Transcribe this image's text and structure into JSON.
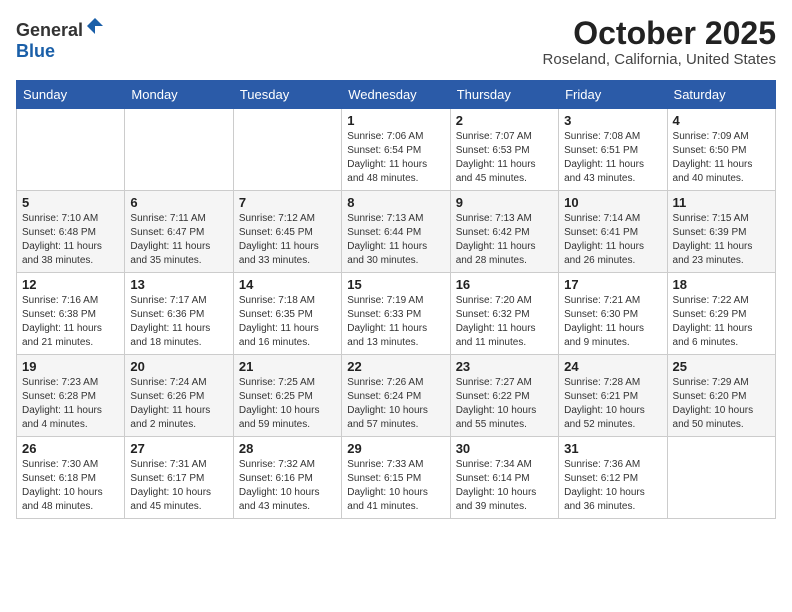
{
  "header": {
    "logo_general": "General",
    "logo_blue": "Blue",
    "month": "October 2025",
    "location": "Roseland, California, United States"
  },
  "weekdays": [
    "Sunday",
    "Monday",
    "Tuesday",
    "Wednesday",
    "Thursday",
    "Friday",
    "Saturday"
  ],
  "weeks": [
    [
      {
        "day": "",
        "info": ""
      },
      {
        "day": "",
        "info": ""
      },
      {
        "day": "",
        "info": ""
      },
      {
        "day": "1",
        "info": "Sunrise: 7:06 AM\nSunset: 6:54 PM\nDaylight: 11 hours\nand 48 minutes."
      },
      {
        "day": "2",
        "info": "Sunrise: 7:07 AM\nSunset: 6:53 PM\nDaylight: 11 hours\nand 45 minutes."
      },
      {
        "day": "3",
        "info": "Sunrise: 7:08 AM\nSunset: 6:51 PM\nDaylight: 11 hours\nand 43 minutes."
      },
      {
        "day": "4",
        "info": "Sunrise: 7:09 AM\nSunset: 6:50 PM\nDaylight: 11 hours\nand 40 minutes."
      }
    ],
    [
      {
        "day": "5",
        "info": "Sunrise: 7:10 AM\nSunset: 6:48 PM\nDaylight: 11 hours\nand 38 minutes."
      },
      {
        "day": "6",
        "info": "Sunrise: 7:11 AM\nSunset: 6:47 PM\nDaylight: 11 hours\nand 35 minutes."
      },
      {
        "day": "7",
        "info": "Sunrise: 7:12 AM\nSunset: 6:45 PM\nDaylight: 11 hours\nand 33 minutes."
      },
      {
        "day": "8",
        "info": "Sunrise: 7:13 AM\nSunset: 6:44 PM\nDaylight: 11 hours\nand 30 minutes."
      },
      {
        "day": "9",
        "info": "Sunrise: 7:13 AM\nSunset: 6:42 PM\nDaylight: 11 hours\nand 28 minutes."
      },
      {
        "day": "10",
        "info": "Sunrise: 7:14 AM\nSunset: 6:41 PM\nDaylight: 11 hours\nand 26 minutes."
      },
      {
        "day": "11",
        "info": "Sunrise: 7:15 AM\nSunset: 6:39 PM\nDaylight: 11 hours\nand 23 minutes."
      }
    ],
    [
      {
        "day": "12",
        "info": "Sunrise: 7:16 AM\nSunset: 6:38 PM\nDaylight: 11 hours\nand 21 minutes."
      },
      {
        "day": "13",
        "info": "Sunrise: 7:17 AM\nSunset: 6:36 PM\nDaylight: 11 hours\nand 18 minutes."
      },
      {
        "day": "14",
        "info": "Sunrise: 7:18 AM\nSunset: 6:35 PM\nDaylight: 11 hours\nand 16 minutes."
      },
      {
        "day": "15",
        "info": "Sunrise: 7:19 AM\nSunset: 6:33 PM\nDaylight: 11 hours\nand 13 minutes."
      },
      {
        "day": "16",
        "info": "Sunrise: 7:20 AM\nSunset: 6:32 PM\nDaylight: 11 hours\nand 11 minutes."
      },
      {
        "day": "17",
        "info": "Sunrise: 7:21 AM\nSunset: 6:30 PM\nDaylight: 11 hours\nand 9 minutes."
      },
      {
        "day": "18",
        "info": "Sunrise: 7:22 AM\nSunset: 6:29 PM\nDaylight: 11 hours\nand 6 minutes."
      }
    ],
    [
      {
        "day": "19",
        "info": "Sunrise: 7:23 AM\nSunset: 6:28 PM\nDaylight: 11 hours\nand 4 minutes."
      },
      {
        "day": "20",
        "info": "Sunrise: 7:24 AM\nSunset: 6:26 PM\nDaylight: 11 hours\nand 2 minutes."
      },
      {
        "day": "21",
        "info": "Sunrise: 7:25 AM\nSunset: 6:25 PM\nDaylight: 10 hours\nand 59 minutes."
      },
      {
        "day": "22",
        "info": "Sunrise: 7:26 AM\nSunset: 6:24 PM\nDaylight: 10 hours\nand 57 minutes."
      },
      {
        "day": "23",
        "info": "Sunrise: 7:27 AM\nSunset: 6:22 PM\nDaylight: 10 hours\nand 55 minutes."
      },
      {
        "day": "24",
        "info": "Sunrise: 7:28 AM\nSunset: 6:21 PM\nDaylight: 10 hours\nand 52 minutes."
      },
      {
        "day": "25",
        "info": "Sunrise: 7:29 AM\nSunset: 6:20 PM\nDaylight: 10 hours\nand 50 minutes."
      }
    ],
    [
      {
        "day": "26",
        "info": "Sunrise: 7:30 AM\nSunset: 6:18 PM\nDaylight: 10 hours\nand 48 minutes."
      },
      {
        "day": "27",
        "info": "Sunrise: 7:31 AM\nSunset: 6:17 PM\nDaylight: 10 hours\nand 45 minutes."
      },
      {
        "day": "28",
        "info": "Sunrise: 7:32 AM\nSunset: 6:16 PM\nDaylight: 10 hours\nand 43 minutes."
      },
      {
        "day": "29",
        "info": "Sunrise: 7:33 AM\nSunset: 6:15 PM\nDaylight: 10 hours\nand 41 minutes."
      },
      {
        "day": "30",
        "info": "Sunrise: 7:34 AM\nSunset: 6:14 PM\nDaylight: 10 hours\nand 39 minutes."
      },
      {
        "day": "31",
        "info": "Sunrise: 7:36 AM\nSunset: 6:12 PM\nDaylight: 10 hours\nand 36 minutes."
      },
      {
        "day": "",
        "info": ""
      }
    ]
  ]
}
